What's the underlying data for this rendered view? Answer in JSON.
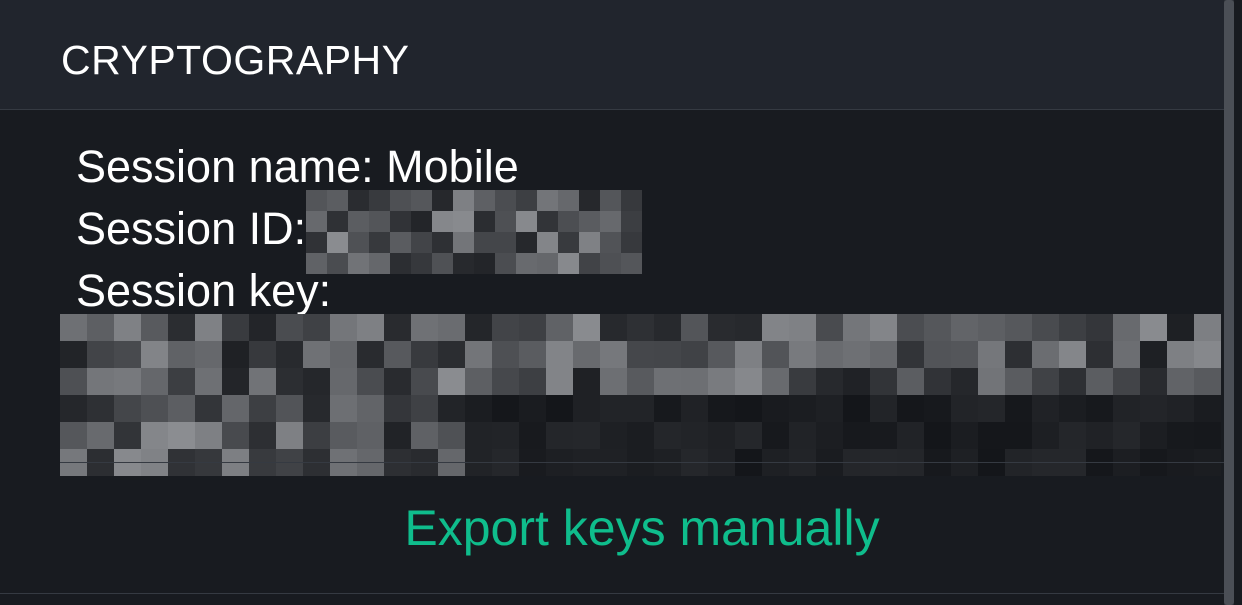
{
  "section": {
    "title": "CRYPTOGRAPHY"
  },
  "session": {
    "name_label": "Session name: Mobile",
    "id_label": "Session ID:",
    "key_label": "Session key:"
  },
  "actions": {
    "export_label": "Export keys manually"
  },
  "colors": {
    "background": "#181b20",
    "header_background": "#21252d",
    "accent": "#0fbd8c",
    "text": "#ffffff"
  }
}
